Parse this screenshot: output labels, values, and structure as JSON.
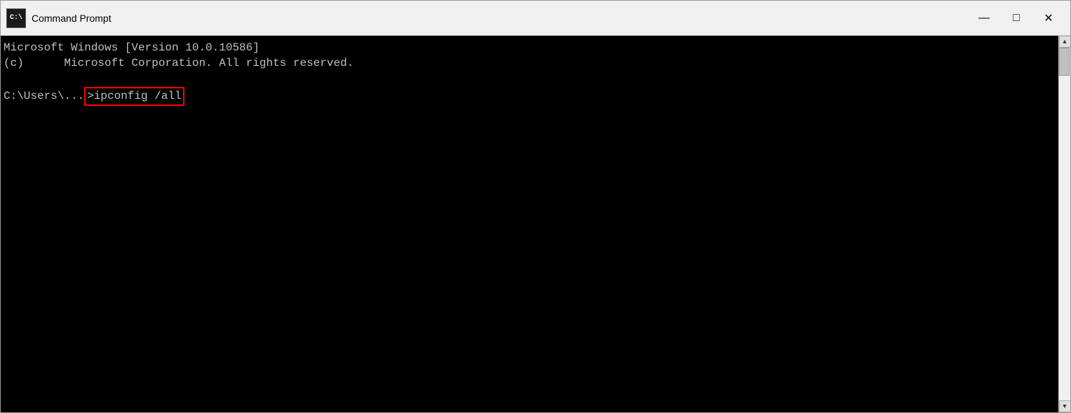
{
  "titleBar": {
    "title": "Command Prompt",
    "icon_label": "C:\\",
    "minimize_label": "—",
    "maximize_label": "□",
    "close_label": "✕"
  },
  "terminal": {
    "line1": "Microsoft Windows [Version 10.0.10586]",
    "line2": "(c)      Microsoft Corporation. All rights reserved.",
    "line3": "",
    "prompt": "C:\\Users\\...",
    "command": ">ipconfig /all"
  }
}
